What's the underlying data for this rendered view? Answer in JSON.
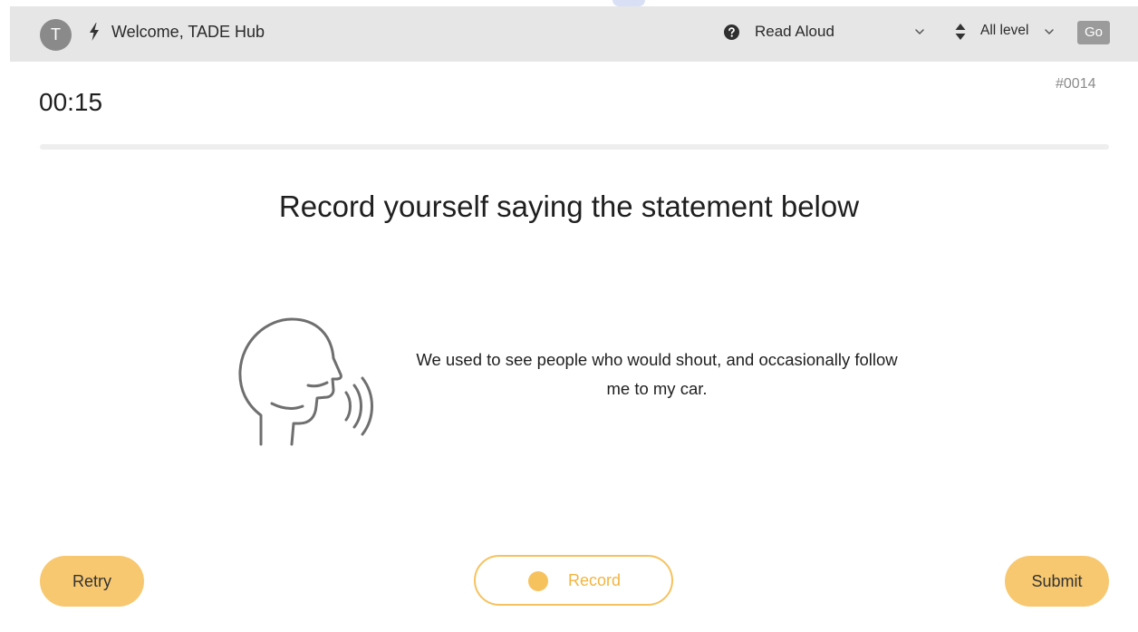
{
  "header": {
    "avatar_initial": "T",
    "welcome_text": "Welcome, TADE Hub",
    "question_type": "Read Aloud",
    "level": "All level",
    "go_label": "Go"
  },
  "question": {
    "id": "#0014",
    "timer": "00:15",
    "instruction": "Record yourself saying the statement below",
    "statement": "We used to see people who would shout, and occasionally follow me to my car."
  },
  "actions": {
    "retry_label": "Retry",
    "record_label": "Record",
    "submit_label": "Submit"
  },
  "icons": {
    "bolt": "lightning-bolt-icon",
    "help": "question-circle-icon",
    "type_dropdown": "chevron-down-icon",
    "sort": "sort-updown-icon",
    "level_dropdown": "chevron-down-icon",
    "speaker": "speaking-head-icon",
    "record_dot": "record-dot-icon"
  },
  "colors": {
    "accent": "#f6c25e",
    "button_fill": "#f7c870",
    "header_bg": "#e6e6e6",
    "go_button": "#9b9b9b"
  }
}
